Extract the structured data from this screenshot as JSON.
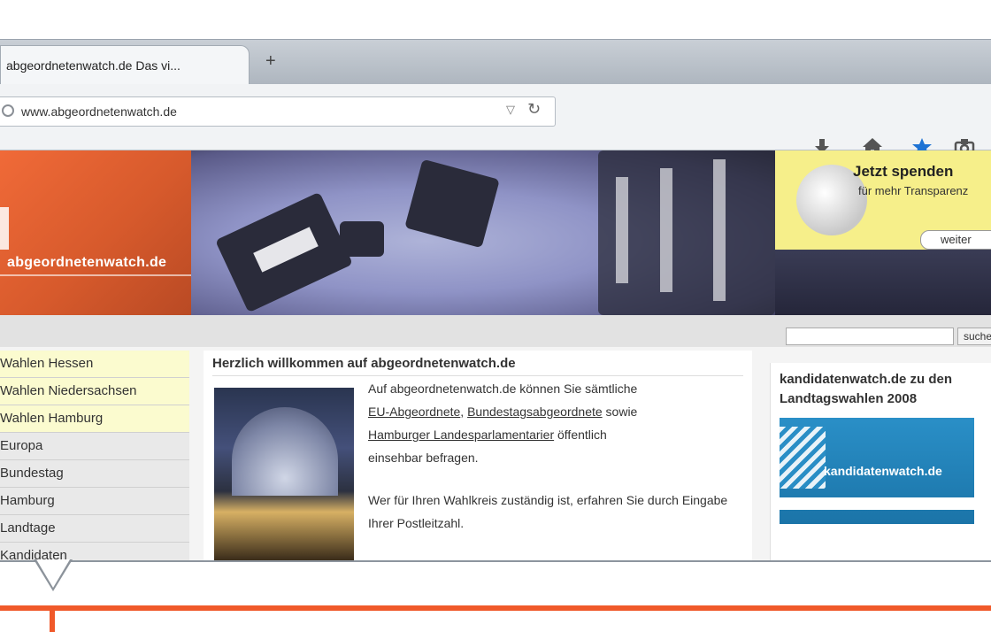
{
  "browser": {
    "tab_title": "abgeordnetenwatch.de Das vi...",
    "new_tab": "+",
    "url": "www.abgeordnetenwatch.de",
    "icons": [
      "download-icon",
      "home-icon",
      "bookmark-star-icon",
      "pocket-icon"
    ],
    "accent": "#1e73d4"
  },
  "site": {
    "logo_text": "abgeordnetenwatch.de",
    "donate": {
      "title": "Jetzt spenden",
      "subtitle": "für mehr Transparenz",
      "button": "weiter"
    },
    "search_button": "suchen",
    "nav": [
      "Wahlen Hessen",
      "Wahlen Niedersachsen",
      "Wahlen Hamburg",
      "Europa",
      "Bundestag",
      "Hamburg",
      "Landtage",
      "Kandidaten"
    ],
    "content": {
      "title": "Herzlich willkommen auf abgeordnetenwatch.de",
      "p1_before": "Auf abgeordnetenwatch.de können Sie sämtliche",
      "link1": "EU-Abgeordnete",
      "link2": "Bundestagsabgeordnete",
      "p1_middle": "sowie",
      "link3": "Hamburger Landesparlamentarier",
      "p1_after": "öffentlich",
      "p1_end": "einsehbar befragen.",
      "p2": "Wer für Ihren Wahlkreis zuständig ist, erfahren Sie durch Eingabe Ihrer Postleitzahl."
    },
    "widget": {
      "title": "kandidatenwatch.de zu den Landtagswahlen 2008",
      "image_label": "kandidatenwatch.de"
    },
    "colors": {
      "brand_orange": "#f0592a",
      "highlight_yellow": "#fbfbcf"
    }
  }
}
